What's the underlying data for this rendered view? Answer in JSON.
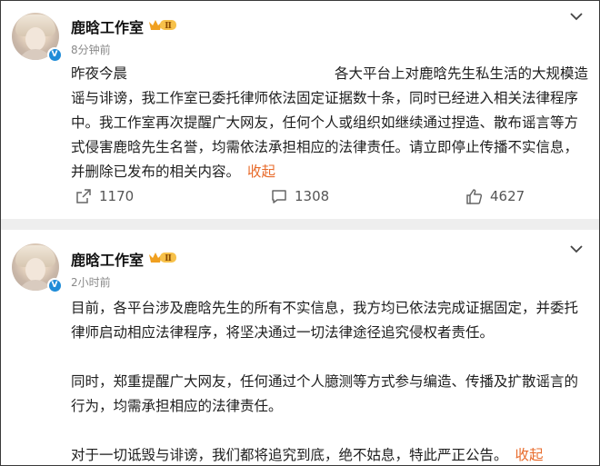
{
  "posts": [
    {
      "author": "鹿晗工作室",
      "vip_level": "Ⅱ",
      "time": "8分钟前",
      "text_first_start": "昨夜今晨",
      "text_first_end": "各大平台上对鹿晗先生私生活的大规",
      "text_rest": "模造谣与诽谤，我工作室已委托律师依法固定证据数十条，同时已经进入相关法律程序中。我工作室再次提醒广大网友，任何个人或组织如继续通过捏造、散布谣言等方式侵害鹿晗先生名誉，均需依法承担相应的法律责任。请立即停止传播不实信息，并删除已发布的相关内容。",
      "fold_label": "收起",
      "reposts": "1170",
      "comments": "1308",
      "likes": "4627"
    },
    {
      "author": "鹿晗工作室",
      "vip_level": "Ⅱ",
      "time": "2小时前",
      "paragraphs": [
        "目前，各平台涉及鹿晗先生的所有不实信息，我方均已依法完成证据固定，并委托律师启动相应法律程序，将坚决通过一切法律途径追究侵权者责任。",
        "同时，郑重提醒广大网友，任何通过个人臆测等方式参与编造、传播及扩散谣言的行为，均需承担相应的法律责任。",
        "对于一切诋毁与诽谤，我们都将追究到底，绝不姑息，特此严正公告。"
      ],
      "fold_label": "收起"
    }
  ],
  "colors": {
    "accent": "#e86b2b",
    "verified": "#1f8cd8",
    "muted": "#8a8a8a",
    "divider": "#eeeeee"
  },
  "icons": [
    "chevron-down-icon",
    "verified-icon",
    "vip-crown-icon",
    "repost-icon",
    "comment-icon",
    "like-icon"
  ]
}
